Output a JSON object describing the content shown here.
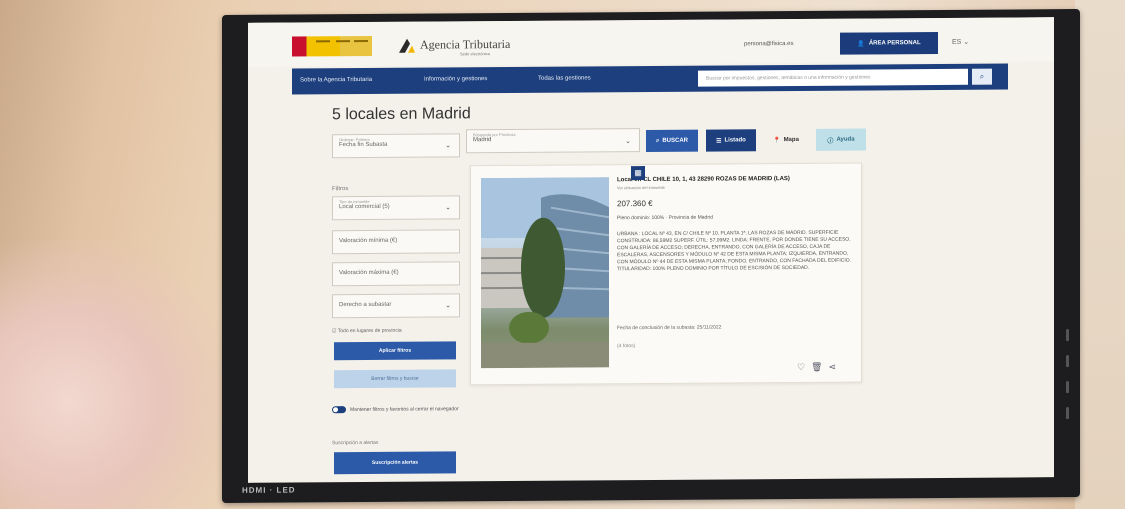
{
  "header": {
    "agency_name": "Agencia Tributaria",
    "agency_sub": "Sede electrónica",
    "top_link": "persona@fisica.es",
    "area_button": "ÁREA PERSONAL",
    "language": "ES"
  },
  "nav": {
    "items": [
      "Sobre la Agencia Tributaria",
      "Información y gestiones",
      "Todas las gestiones"
    ],
    "search_placeholder": "Buscar por impuestos, gestiones, temáticas o una información y gestiones"
  },
  "page": {
    "title": "5 locales en Madrid"
  },
  "sidebar": {
    "sort_label": "Ordenar: Primero",
    "sort_value": "Fecha fin Subasta",
    "filters_title": "Filtros",
    "type_label": "Tipo de inmueble",
    "type_value": "Local comercial (5)",
    "min_placeholder": "Valoración mínima (€)",
    "max_placeholder": "Valoración máxima (€)",
    "right_placeholder": "Derecho a subastar",
    "checkbox_label": "Todo en lugares de provincia",
    "apply_button": "Aplicar filtros",
    "clear_button": "Borrar filtros y buscar",
    "toggle_label": "Mantener filtros y favoritos al cerrar el navegador",
    "subscribe_label": "Suscripción a alertas",
    "subscribe_button": "Suscripción alertas"
  },
  "toolbar": {
    "province_label": "Búsqueda por Provincia",
    "province_value": "Madrid",
    "search_button": "BUSCAR",
    "list_button": "Listado",
    "map_button": "Mapa",
    "help_button": "Ayuda"
  },
  "listing": {
    "title": "Local en CL CHILE 10, 1, 43 28290 ROZAS DE MADRID (LAS)",
    "subtitle": "Ver ubicación del inmueble",
    "price": "207.360 €",
    "ownership": "Pleno dominio: 100% · Provincia de Madrid",
    "description": "URBANA : LOCAL Nº 43, EN C/ CHILE Nº 10, PLANTA 1ª, LAS ROZAS DE MADRID. SUPERFICIE CONSTRUIDA: 86,59M2 SUPERF. ÚTIL: 57,09M2. LINDA: FRENTE, POR DONDE TIENE SU ACCESO, CON GALERÍA DE ACCESO; DERECHA, ENTRANDO, CON GALERÍA DE ACCESO, CAJA DE ESCALERAS, ASCENSORES Y MÓDULO Nº 42 DE ESTA MISMA PLANTA; IZQUIERDA, ENTRANDO, CON MÓDULO Nº 44 DE ESTA MISMA PLANTA; FONDO, ENTRANDO, CON FACHADA DEL EDIFICIO. TITULARIDAD: 100% PLENO DOMINIO POR TÍTULO DE ESCISIÓN DE SOCIEDAD.",
    "closing_date": "Fecha de conclusión de la subasta: 25/11/2022",
    "photos": "(4 fotos)"
  },
  "monitor": {
    "brand": "HDMI  ·  LED"
  },
  "colors": {
    "brand_blue": "#1d3f7d",
    "button_blue": "#2c5aa8"
  }
}
